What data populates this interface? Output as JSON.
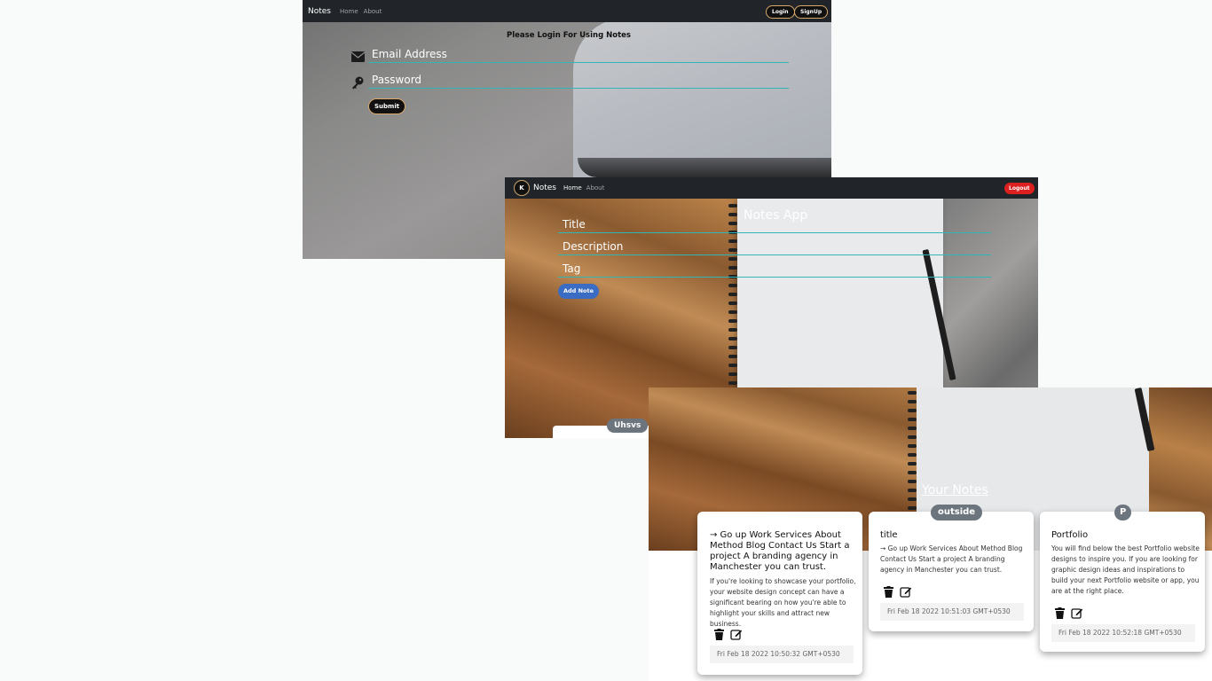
{
  "login_window": {
    "brand": "Notes",
    "nav": [
      "Home",
      "About"
    ],
    "login_button": "Login",
    "signup_button": "SignUp",
    "heading": "Please Login For Using Notes",
    "email_placeholder": "Email Address",
    "password_placeholder": "Password",
    "submit_button": "Submit"
  },
  "add_note_window": {
    "logo_letter": "K",
    "brand": "Notes",
    "nav": [
      "Home",
      "About"
    ],
    "logout_button": "Logout",
    "heading": "Notes App",
    "title_placeholder": "Title",
    "description_placeholder": "Description",
    "tag_placeholder": "Tag",
    "add_button": "Add Note",
    "peek_tag": "Uhsvs"
  },
  "notes_window": {
    "heading": "Your Notes",
    "notes": [
      {
        "tag": "",
        "title": "→ Go up Work Services About Method Blog Contact Us Start a project A branding agency in Manchester you can trust.",
        "description": "If you're looking to showcase your portfolio, your website design concept can have a significant bearing on how you're able to highlight your skills and attract new business.",
        "date": "Fri Feb 18 2022 10:50:32 GMT+0530"
      },
      {
        "tag": "outside",
        "title": "title",
        "description": "→ Go up Work Services About Method Blog Contact Us Start a project A branding agency in Manchester you can trust.",
        "date": "Fri Feb 18 2022 10:51:03 GMT+0530"
      },
      {
        "tag": "P",
        "title": "Portfolio",
        "description": "You will find below the best Portfolio website designs to inspire you. If you are looking for graphic design ideas and inspirations to build your next Portfolio website or app, you are at the right place.",
        "date": "Fri Feb 18 2022 10:52:18 GMT+0530"
      }
    ]
  },
  "colors": {
    "navbar": "#212529",
    "accent_line": "#2fb6b6",
    "logout": "#dc1f1f",
    "add_note": "#3b6cc4",
    "tag_badge": "#6c757d"
  },
  "icons": [
    "envelope-icon",
    "key-icon",
    "trash-icon",
    "edit-icon"
  ]
}
